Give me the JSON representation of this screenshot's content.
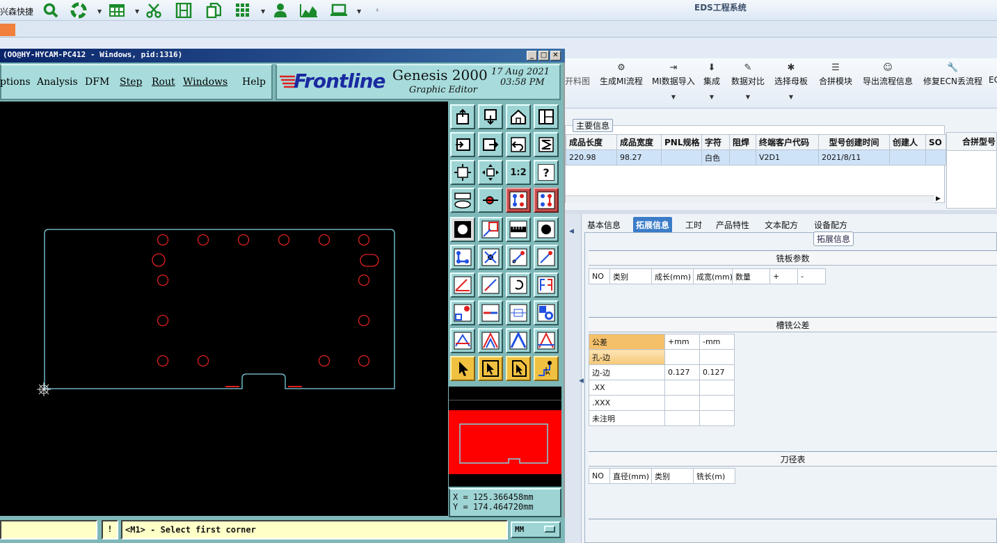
{
  "app_title": "EDS工程系统",
  "quick_toolbar": {
    "label": "兴森快捷",
    "icons": [
      "search-icon",
      "lifebuoy-icon",
      "table-icon",
      "scissors-icon",
      "film-icon",
      "copy-icon",
      "grid-icon",
      "user-icon",
      "area-chart-icon",
      "laptop-icon"
    ]
  },
  "genesis": {
    "title": "(OO@HY-HYCAM-PC412 - Windows, pid:1316)",
    "menu": [
      "ptions",
      "Analysis",
      "DFM",
      "Step",
      "Rout",
      "Windows",
      "Help"
    ],
    "logo": "Frontline",
    "product": "Genesis 2000",
    "subtitle": "Graphic Editor",
    "date": "17 Aug 2021",
    "time": "03:58 PM",
    "scale_btn": "1:2",
    "help_btn": "?",
    "coord_x": "X = 125.366458mm",
    "coord_y": "Y = 174.464720mm",
    "prompt": "<M1> - Select first corner",
    "units": "MM",
    "warn": "!"
  },
  "colors": {
    "canvas": "#000000",
    "outline": "#7fd4e0",
    "pad": "#e02020",
    "panel": "#7fb8b8"
  },
  "right_toolbar": [
    {
      "label": "开料图",
      "icon": ""
    },
    {
      "label": "生成MI流程",
      "icon": "⚙"
    },
    {
      "label": "MI数据导入",
      "icon": "⇥"
    },
    {
      "label": "集成",
      "icon": "⬇"
    },
    {
      "label": "数据对比",
      "icon": "✎"
    },
    {
      "label": "选择母板",
      "icon": "✱"
    },
    {
      "label": "合拼模块",
      "icon": "☰"
    },
    {
      "label": "导出流程信息",
      "icon": "☺"
    },
    {
      "label": "修复ECN丢流程",
      "icon": "🔧"
    },
    {
      "label": "EC",
      "icon": ""
    }
  ],
  "main_info": {
    "group_label": "主要信息",
    "headers": [
      "成品长度",
      "成品宽度",
      "PNL规格",
      "字符",
      "阻焊",
      "终端客户代码",
      "型号创建时间",
      "创建人",
      "SO"
    ],
    "row": [
      "220.98",
      "98.27",
      "",
      "白色",
      "",
      "V2D1",
      "2021/8/11",
      "",
      ""
    ],
    "side_header": "合拼型号"
  },
  "tabs": [
    "基本信息",
    "拓展信息",
    "工时",
    "产品特性",
    "文本配方",
    "设备配方"
  ],
  "active_tab": "拓展信息",
  "ext_label": "拓展信息",
  "milling": {
    "title": "铣板参数",
    "headers": [
      "NO",
      "类别",
      "成长(mm)",
      "成宽(mm)",
      "数量",
      "+",
      "-"
    ]
  },
  "slot": {
    "title": "槽铣公差",
    "headers": [
      "公差",
      "+mm",
      "-mm"
    ],
    "rows": [
      [
        "孔-边",
        "",
        ""
      ],
      [
        "边-边",
        "0.127",
        "0.127"
      ],
      [
        ".XX",
        "",
        ""
      ],
      [
        ".XXX",
        "",
        ""
      ],
      [
        "未注明",
        "",
        ""
      ]
    ]
  },
  "tool": {
    "title": "刀径表",
    "headers": [
      "NO",
      "直径(mm)",
      "类别",
      "铣长(m)"
    ]
  }
}
